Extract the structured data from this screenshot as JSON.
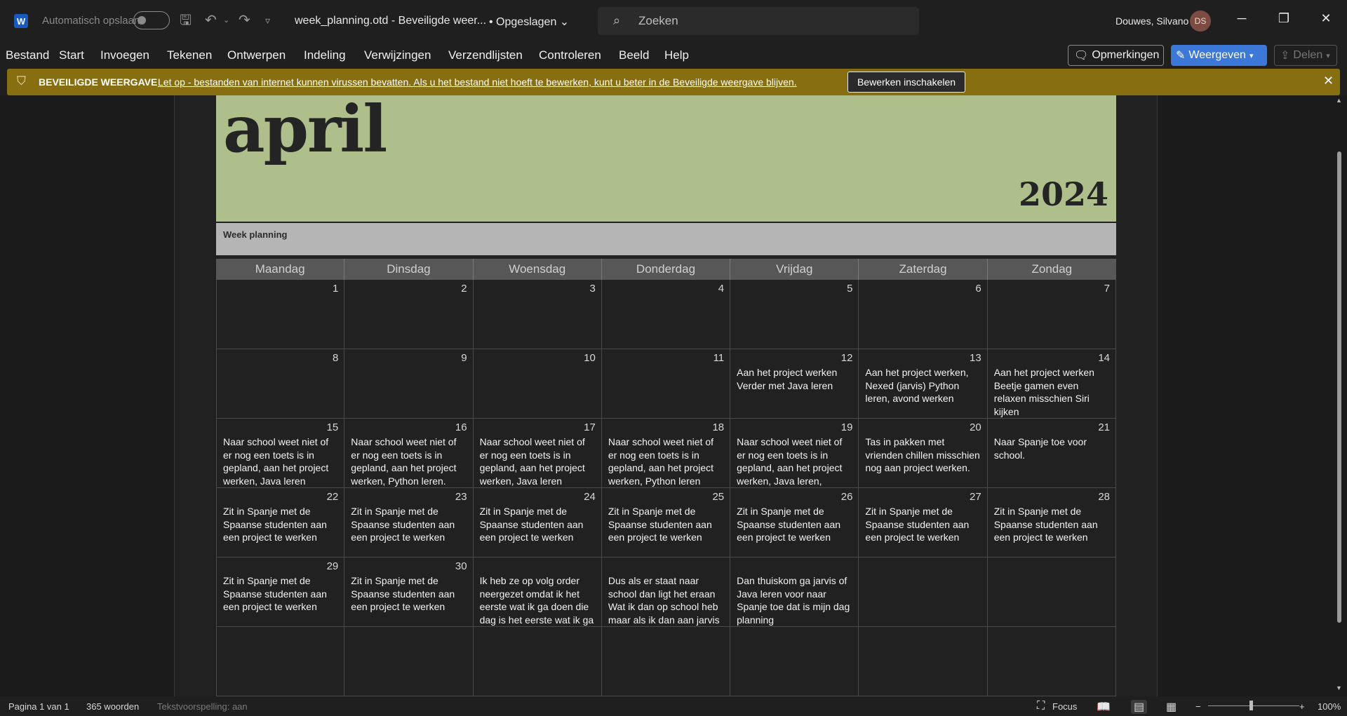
{
  "titlebar": {
    "app_logo": "W",
    "autosave_label": "Automatisch opslaan",
    "doc_title": "week_planning.otd  -  Beveiligde weer...",
    "save_status": "• Opgeslagen",
    "search_placeholder": "Zoeken",
    "user_name": "Douwes, Silvano",
    "user_initials": "DS"
  },
  "menu": [
    "Bestand",
    "Start",
    "Invoegen",
    "Tekenen",
    "Ontwerpen",
    "Indeling",
    "Verwijzingen",
    "Verzendlijsten",
    "Controleren",
    "Beeld",
    "Help"
  ],
  "ribbon_actions": {
    "comments": "Opmerkingen",
    "view": "Weergeven",
    "share": "Delen"
  },
  "protected_view": {
    "title": "BEVEILIGDE WEERGAVE",
    "message": "Let op - bestanden van internet kunnen virussen bevatten. Als u het bestand niet hoeft te bewerken, kunt u beter in de Beveiligde weergave blijven.",
    "button": "Bewerken inschakelen"
  },
  "calendar": {
    "month": "april",
    "year": "2024",
    "subtitle": "Week planning",
    "weekdays": [
      "Maandag",
      "Dinsdag",
      "Woensdag",
      "Donderdag",
      "Vrijdag",
      "Zaterdag",
      "Zondag"
    ],
    "cells": [
      {
        "num": "1",
        "note": ""
      },
      {
        "num": "2",
        "note": ""
      },
      {
        "num": "3",
        "note": ""
      },
      {
        "num": "4",
        "note": ""
      },
      {
        "num": "5",
        "note": ""
      },
      {
        "num": "6",
        "note": ""
      },
      {
        "num": "7",
        "note": ""
      },
      {
        "num": "8",
        "note": ""
      },
      {
        "num": "9",
        "note": ""
      },
      {
        "num": "10",
        "note": ""
      },
      {
        "num": "11",
        "note": ""
      },
      {
        "num": "12",
        "note": "Aan het project werken\nVerder met Java leren"
      },
      {
        "num": "13",
        "note": "Aan het project werken, Nexed (jarvis) Python leren, avond werken"
      },
      {
        "num": "14",
        "note": "Aan het project werken\nBeetje gamen even relaxen misschien Siri kijken"
      },
      {
        "num": "15",
        "note": "Naar school weet niet of er nog een toets is in gepland,  aan het project werken, Java  leren"
      },
      {
        "num": "16",
        "note": "Naar school weet niet of er nog een toets is in gepland, aan het project werken, Python leren."
      },
      {
        "num": "17",
        "note": "Naar school weet niet of er nog een toets is in gepland,  aan het project werken, Java leren"
      },
      {
        "num": "18",
        "note": "Naar school weet niet of er nog een toets is in gepland,  aan het project werken, Python leren"
      },
      {
        "num": "19",
        "note": "Naar school weet niet of er nog een toets is in gepland,  aan het project werken, Java leren,"
      },
      {
        "num": "20",
        "note": "Tas in pakken met vrienden chillen misschien nog aan project werken."
      },
      {
        "num": "21",
        "note": "Naar Spanje toe voor school."
      },
      {
        "num": "22",
        "note": "Zit in Spanje met de Spaanse studenten aan een project te werken"
      },
      {
        "num": "23",
        "note": "Zit in Spanje met de Spaanse studenten aan een project te werken"
      },
      {
        "num": "24",
        "note": "Zit in Spanje met de Spaanse studenten aan een project te werken"
      },
      {
        "num": "25",
        "note": "Zit in Spanje met de Spaanse studenten aan een project te werken"
      },
      {
        "num": "26",
        "note": "Zit in Spanje met de Spaanse studenten aan een project te werken"
      },
      {
        "num": "27",
        "note": "Zit in Spanje met de Spaanse studenten aan een project te werken"
      },
      {
        "num": "28",
        "note": "Zit in Spanje met de Spaanse studenten aan een project te werken"
      },
      {
        "num": "29",
        "note": "Zit in Spanje met de Spaanse studenten aan een project te werken"
      },
      {
        "num": "30",
        "note": "Zit in Spanje met de Spaanse studenten aan een project te werken"
      },
      {
        "num": "",
        "note": "Ik heb ze op volg order neergezet omdat ik het eerste wat ik ga doen die dag is het eerste wat ik ga"
      },
      {
        "num": "",
        "note": "Dus als er staat naar school dan ligt het eraan\nWat ik dan op school heb maar als ik dan aan jarvis"
      },
      {
        "num": "",
        "note": "Dan thuiskom ga jarvis of Java leren voor naar Spanje toe dat is mijn dag planning"
      },
      {
        "num": "",
        "note": ""
      },
      {
        "num": "",
        "note": ""
      },
      {
        "num": "",
        "note": ""
      },
      {
        "num": "",
        "note": ""
      },
      {
        "num": "",
        "note": ""
      },
      {
        "num": "",
        "note": ""
      },
      {
        "num": "",
        "note": ""
      },
      {
        "num": "",
        "note": ""
      },
      {
        "num": "",
        "note": ""
      }
    ]
  },
  "statusbar": {
    "page": "Pagina 1 van 1",
    "words": "365 woorden",
    "prediction": "Tekstvoorspelling: aan",
    "focus": "Focus",
    "zoom": "100%"
  },
  "colors": {
    "header_green": "#aebf8c",
    "protect_bar": "#876e10",
    "accent_blue": "#3b78d8"
  }
}
